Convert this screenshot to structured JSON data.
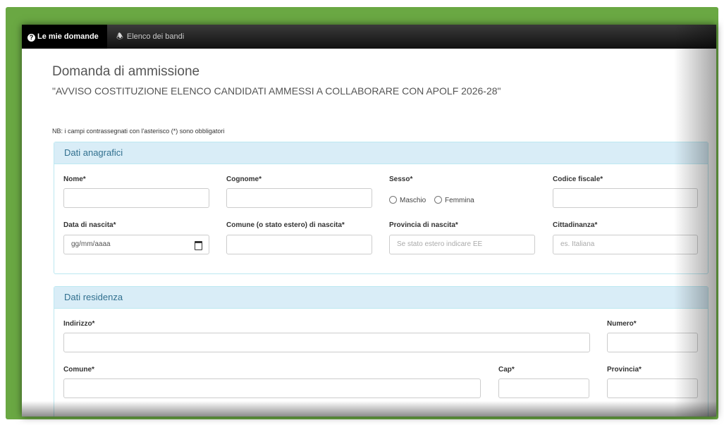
{
  "nav": {
    "active_tab": "Le mie domande",
    "second_tab": "Elenco dei bandi",
    "active_icon": "question-circle-icon",
    "second_icon": "megaphone-icon"
  },
  "page": {
    "title": "Domanda di ammissione",
    "subtitle": "\"AVVISO COSTITUZIONE ELENCO CANDIDATI AMMESSI A COLLABORARE CON APOLF 2026-28\"",
    "note": "NB: i campi contrassegnati con l'asterisco (*) sono obbligatori"
  },
  "anagrafici": {
    "heading": "Dati anagrafici",
    "nome_label": "Nome*",
    "cognome_label": "Cognome*",
    "sesso_label": "Sesso*",
    "sesso_options": [
      "Maschio",
      "Femmina"
    ],
    "codice_fiscale_label": "Codice fiscale*",
    "data_nascita_label": "Data di nascita*",
    "data_nascita_value": "gg/mm/aaaa",
    "comune_nascita_label": "Comune (o stato estero) di nascita*",
    "provincia_nascita_label": "Provincia di nascita*",
    "provincia_nascita_placeholder": "Se stato estero indicare EE",
    "cittadinanza_label": "Cittadinanza*",
    "cittadinanza_placeholder": "es. Italiana"
  },
  "residenza": {
    "heading": "Dati residenza",
    "indirizzo_label": "Indirizzo*",
    "numero_label": "Numero*",
    "comune_label": "Comune*",
    "cap_label": "Cap*",
    "provincia_label": "Provincia*"
  },
  "colors": {
    "frame": "#6aa843",
    "panel_heading_bg": "#d9edf7",
    "panel_heading_text": "#31708f",
    "navbar": "#111111"
  }
}
